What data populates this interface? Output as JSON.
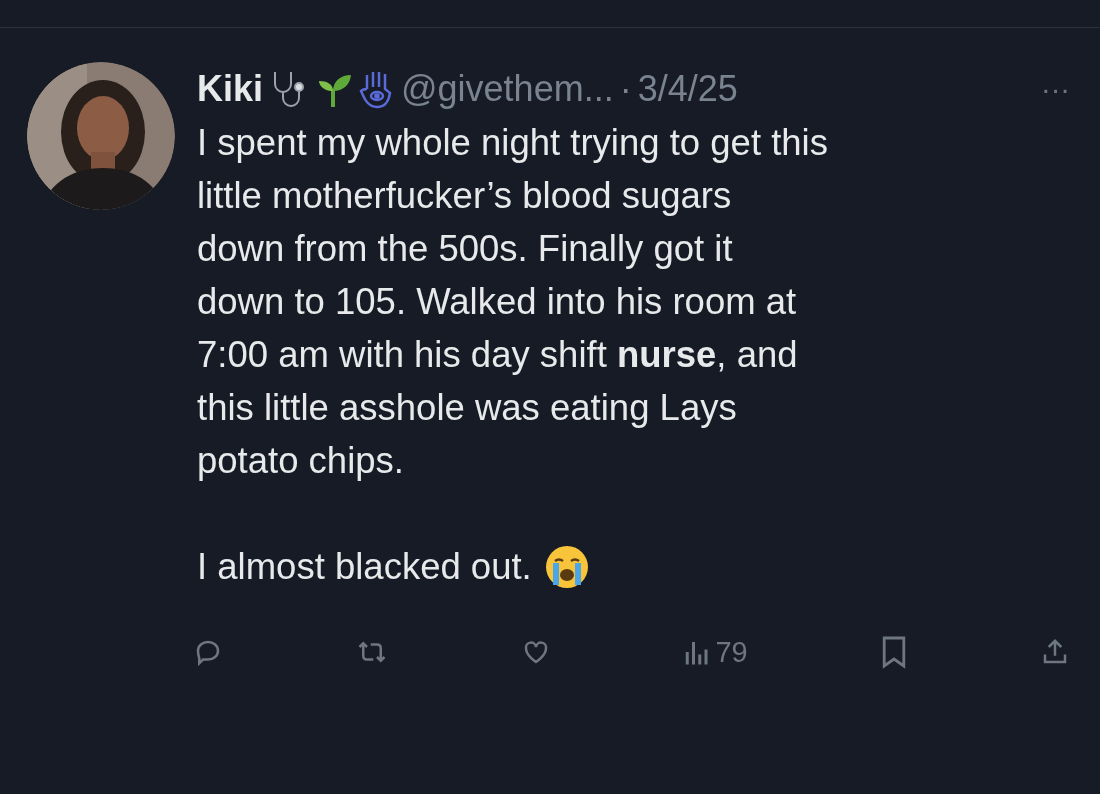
{
  "tweet": {
    "author_name": "Kiki",
    "handle": "@givethem...",
    "separator": "·",
    "date": "3/4/25",
    "more": "···",
    "body": "I spent my whole night trying to get this\nlittle motherfucker’s blood sugars\ndown from the 500s. Finally got it\ndown to 105. Walked into his room at\n7:00 am with his day shift **nurse**, and\nthis little asshole was eating Lays\npotato chips.",
    "last_line": "I almost blacked out.",
    "actions": [
      {
        "kind": "reply"
      },
      {
        "kind": "repost"
      },
      {
        "kind": "like"
      },
      {
        "kind": "views",
        "count": "79"
      },
      {
        "kind": "bookmark"
      },
      {
        "kind": "share"
      }
    ]
  }
}
